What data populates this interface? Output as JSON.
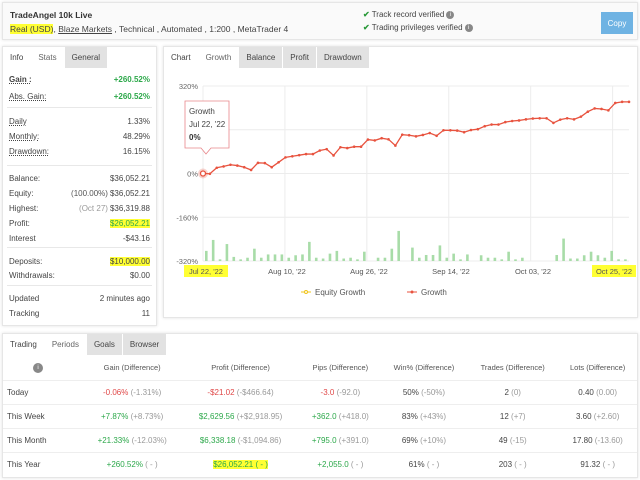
{
  "header": {
    "title": "TradeAngel 10k Live",
    "account_type": "Real (USD)",
    "broker": "Blaze Markets",
    "details": " , Technical , Automated , 1:200 , MetaTrader 4",
    "verified": [
      "Track record verified",
      "Trading privileges verified"
    ],
    "copy_label": "Copy"
  },
  "left": {
    "tabs": [
      "Info",
      "Stats",
      "General"
    ],
    "active_tab": "Info",
    "stats": [
      {
        "label": "Gain :",
        "value": "+260.52%",
        "color": "green"
      },
      {
        "label": "Abs. Gain:",
        "value": "+260.52%",
        "color": "green"
      },
      {
        "label": "Daily",
        "value": "1.33%"
      },
      {
        "label": "Monthly:",
        "value": "48.29%"
      },
      {
        "label": "Drawdown:",
        "value": "16.15%"
      },
      {
        "label": "Balance:",
        "value": "$36,052.21"
      },
      {
        "label": "Equity:",
        "prefix": "(100.00%)",
        "value": "$36,052.21"
      },
      {
        "label": "Highest:",
        "prefix": "(Oct 27)",
        "value": "$36,319.88"
      },
      {
        "label": "Profit:",
        "value": "$26,052.21",
        "color": "green",
        "highlight": true
      },
      {
        "label": "Interest",
        "value": "-$43.16"
      },
      {
        "label": "Deposits:",
        "value": "$10,000.00",
        "highlight": true
      },
      {
        "label": "Withdrawals:",
        "value": "$0.00"
      },
      {
        "label": "Updated",
        "value": "2 minutes ago"
      },
      {
        "label": "Tracking",
        "value": "11"
      }
    ]
  },
  "chart": {
    "tabs": [
      "Chart",
      "Growth",
      "Balance",
      "Profit",
      "Drawdown"
    ],
    "active_tab": "Growth",
    "tooltip": {
      "title": "Growth",
      "date": "Jul 22, '22",
      "value": "0%"
    }
  },
  "chart_data": {
    "type": "line",
    "yticks": [
      "320%",
      "0%",
      "-160%",
      "-320%"
    ],
    "ylim": [
      -320,
      320
    ],
    "xticks": [
      "Jul 22, '22",
      "Aug 10, '22",
      "Aug 26, '22",
      "Sep 14, '22",
      "Oct 03, '22",
      "Oct 25, '22"
    ],
    "legend": [
      "Equity Growth",
      "Growth"
    ],
    "legend_position": "bottom",
    "grid": true,
    "colors": {
      "growth": "#e8533f",
      "equity": "#f0c419",
      "bars": "#a8dca8"
    },
    "series": [
      {
        "name": "Growth",
        "values": [
          0,
          -1,
          21,
          26,
          32,
          29,
          23,
          13,
          39,
          38,
          23,
          41,
          59,
          63,
          67,
          71,
          71,
          84,
          89,
          66,
          96,
          93,
          98,
          98,
          124,
          121,
          129,
          125,
          102,
          142,
          140,
          136,
          141,
          148,
          138,
          158,
          158,
          157,
          151,
          159,
          162,
          173,
          179,
          179,
          188,
          192,
          194,
          198,
          201,
          202,
          202,
          185,
          197,
          202,
          198,
          208,
          226,
          238,
          236,
          231,
          258,
          262,
          262
        ]
      }
    ],
    "bars": [
      37,
      77,
      6,
      62,
      15,
      6,
      12,
      45,
      12,
      24,
      24,
      24,
      12,
      21,
      24,
      70,
      12,
      9,
      27,
      37,
      9,
      12,
      6,
      34,
      0,
      12,
      12,
      45,
      110,
      0,
      49,
      12,
      22,
      22,
      57,
      12,
      27,
      6,
      24,
      0,
      21,
      12,
      12,
      6,
      34,
      6,
      12,
      0,
      0,
      0,
      0,
      22,
      82,
      9,
      9,
      21,
      34,
      21,
      12,
      37,
      6,
      6
    ]
  },
  "periods": {
    "tabs": [
      "Trading",
      "Periods",
      "Goals",
      "Browser"
    ],
    "active_tab": "Periods",
    "columns": [
      "Gain (Difference)",
      "Profit (Difference)",
      "Pips (Difference)",
      "Win% (Difference)",
      "Trades (Difference)",
      "Lots (Difference)"
    ],
    "rows": [
      {
        "label": "Today",
        "cells": [
          [
            "-0.06%",
            "(-1.31%)",
            "red"
          ],
          [
            "-$21.02",
            "(-$466.64)",
            "red"
          ],
          [
            "-3.0",
            "(-92.0)",
            "red"
          ],
          [
            "50%",
            "(-50%)",
            ""
          ],
          [
            "2",
            "(0)",
            ""
          ],
          [
            "0.40",
            "(0.00)",
            ""
          ]
        ]
      },
      {
        "label": "This Week",
        "cells": [
          [
            "+7.87%",
            "(+8.73%)",
            "green"
          ],
          [
            "$2,629.56",
            "(+$2,918.95)",
            "green"
          ],
          [
            "+362.0",
            "(+418.0)",
            "green"
          ],
          [
            "83%",
            "(+43%)",
            ""
          ],
          [
            "12",
            "(+7)",
            ""
          ],
          [
            "3.60",
            "(+2.60)",
            ""
          ]
        ]
      },
      {
        "label": "This Month",
        "cells": [
          [
            "+21.33%",
            "(-12.03%)",
            "green"
          ],
          [
            "$6,338.18",
            "(-$1,094.86)",
            "green"
          ],
          [
            "+795.0",
            "(+391.0)",
            "green"
          ],
          [
            "69%",
            "(+10%)",
            ""
          ],
          [
            "49",
            "(-15)",
            ""
          ],
          [
            "17.80",
            "(-13.60)",
            ""
          ]
        ]
      },
      {
        "label": "This Year",
        "cells": [
          [
            "+260.52%",
            "( - )",
            "green"
          ],
          [
            "$26,052.21",
            "( - )",
            "green"
          ],
          [
            "+2,055.0",
            "( - )",
            "green"
          ],
          [
            "61%",
            "( - )",
            ""
          ],
          [
            "203",
            "( - )",
            ""
          ],
          [
            "91.32",
            "( - )",
            ""
          ]
        ]
      }
    ]
  }
}
